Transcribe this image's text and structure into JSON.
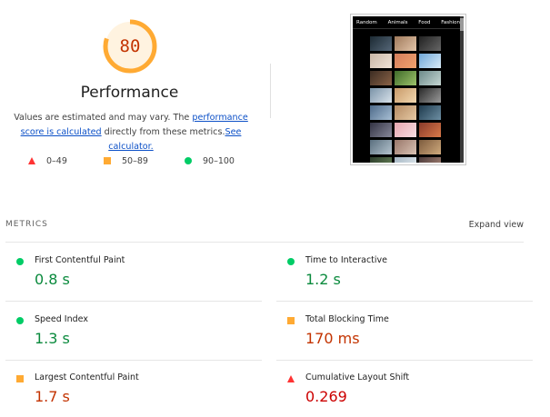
{
  "gauge": {
    "score": "80",
    "score_fraction": 0.8,
    "ring_color": "#ffaa33",
    "bg_color": "#fff3e0",
    "text_color": "#c33300"
  },
  "performance": {
    "title": "Performance",
    "desc_prefix": "Values are estimated and may vary. The ",
    "link_score": "performance score is calculated",
    "desc_middle": " directly from these metrics.",
    "link_calc": "See calculator."
  },
  "legend": [
    {
      "icon": "triangle-icon",
      "label": "0–49",
      "color": "#ff3333"
    },
    {
      "icon": "square-icon",
      "label": "50–89",
      "color": "#ffaa33"
    },
    {
      "icon": "circle-icon",
      "label": "90–100",
      "color": "#00cc66"
    }
  ],
  "thumbnail": {
    "nav": [
      "Random",
      "Animals",
      "Food",
      "Fashion"
    ]
  },
  "metrics": {
    "header": "METRICS",
    "expand": "Expand view",
    "items": [
      {
        "label": "First Contentful Paint",
        "value": "0.8 s",
        "status": "good"
      },
      {
        "label": "Time to Interactive",
        "value": "1.2 s",
        "status": "good"
      },
      {
        "label": "Speed Index",
        "value": "1.3 s",
        "status": "good"
      },
      {
        "label": "Total Blocking Time",
        "value": "170 ms",
        "status": "average"
      },
      {
        "label": "Largest Contentful Paint",
        "value": "1.7 s",
        "status": "average"
      },
      {
        "label": "Cumulative Layout Shift",
        "value": "0.269",
        "status": "fail"
      }
    ]
  }
}
